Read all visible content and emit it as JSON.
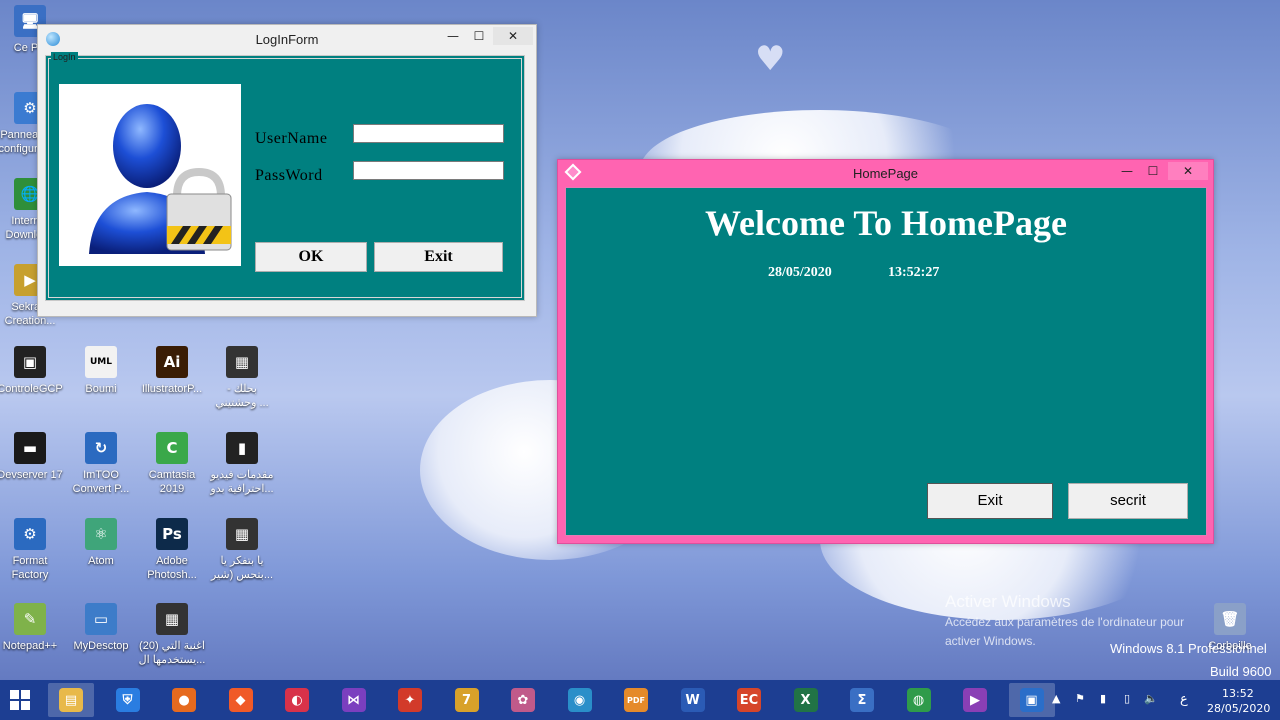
{
  "desktop": {
    "icons": [
      {
        "label": "Ce PC",
        "glyph": "🖥",
        "color": "#3a6fc4"
      },
      {
        "label": "Panneau de configuration",
        "glyph": "⚙",
        "color": "#3b7bd1"
      },
      {
        "label": "Internet Download",
        "glyph": "🌐",
        "color": "#2f8f3a"
      },
      {
        "label": "Sekrani Creation...",
        "glyph": "▶",
        "color": "#c7a02f"
      },
      {
        "label": "ControleGCP",
        "glyph": "▣",
        "color": "#222222"
      },
      {
        "label": "Boumi",
        "glyph": "UML",
        "color": "#f2f2f2"
      },
      {
        "label": "IllustratorP...",
        "glyph": "Ai",
        "color": "#3a1d05"
      },
      {
        "label": "بحلك - وحشتيني ...",
        "glyph": "▦",
        "color": "#333333"
      },
      {
        "label": "Devserver 17",
        "glyph": "▬",
        "color": "#1a1a1a"
      },
      {
        "label": "ImTOO Convert P...",
        "glyph": "↻",
        "color": "#2b6ac0"
      },
      {
        "label": "Camtasia 2019",
        "glyph": "C",
        "color": "#3aa84a"
      },
      {
        "label": "مقدمات فيديو احترافية بدو...",
        "glyph": "▮",
        "color": "#222222"
      },
      {
        "label": "Format Factory",
        "glyph": "⚙",
        "color": "#2b6ac0"
      },
      {
        "label": "Atom",
        "glyph": "⚛",
        "color": "#3fa57a"
      },
      {
        "label": "Adobe Photosh...",
        "glyph": "Ps",
        "color": "#0d2a4a"
      },
      {
        "label": "يا بتفكر يا بتحس (شير...",
        "glyph": "▦",
        "color": "#333333"
      },
      {
        "label": "Notepad++",
        "glyph": "✎",
        "color": "#7fb24a"
      },
      {
        "label": "MyDesctop",
        "glyph": "▭",
        "color": "#3d7cc9"
      },
      {
        "label": "اغنية التي (20) يستخدمها ال...",
        "glyph": "▦",
        "color": "#333333"
      },
      {
        "label": "Corbeille",
        "glyph": "🗑",
        "color": "#8aa0c8"
      }
    ]
  },
  "login_window": {
    "title": "LogInForm",
    "group_label": "LogIn",
    "username_label": "UserName",
    "password_label": "PassWord",
    "username_value": "",
    "password_value": "",
    "ok_label": "OK",
    "exit_label": "Exit",
    "minimize": "—",
    "maximize": "☐",
    "close": "✕"
  },
  "home_window": {
    "title": "HomePage",
    "welcome": "Welcome To HomePage",
    "date": "28/05/2020",
    "time": "13:52:27",
    "exit_label": "Exit",
    "secret_label": "secrit",
    "minimize": "—",
    "maximize": "☐",
    "close": "✕"
  },
  "watermark": {
    "activate_title": "Activer Windows",
    "activate_line1": "Accédez aux paramètres de l'ordinateur pour",
    "activate_line2": "activer Windows.",
    "edition": "Windows 8.1 Professionnel",
    "build": "Build 9600"
  },
  "taskbar": {
    "apps": [
      {
        "name": "file-explorer",
        "glyph": "▤",
        "color": "#e8b94a"
      },
      {
        "name": "shield",
        "glyph": "⛨",
        "color": "#2a7de1"
      },
      {
        "name": "firefox",
        "glyph": "●",
        "color": "#e66a1f"
      },
      {
        "name": "brave",
        "glyph": "◆",
        "color": "#f05a28"
      },
      {
        "name": "opera-neon",
        "glyph": "◐",
        "color": "#d8324a"
      },
      {
        "name": "visual-studio",
        "glyph": "⋈",
        "color": "#7b3fbf"
      },
      {
        "name": "app-red",
        "glyph": "✦",
        "color": "#d23a2a"
      },
      {
        "name": "7zip",
        "glyph": "7",
        "color": "#d8a12a"
      },
      {
        "name": "paint",
        "glyph": "✿",
        "color": "#c05a8a"
      },
      {
        "name": "media",
        "glyph": "◉",
        "color": "#2a8fc9"
      },
      {
        "name": "pdf",
        "glyph": "PDF",
        "color": "#e58a2a"
      },
      {
        "name": "word",
        "glyph": "W",
        "color": "#2b5bb5"
      },
      {
        "name": "app-ec",
        "glyph": "EC",
        "color": "#d6452a"
      },
      {
        "name": "excel",
        "glyph": "X",
        "color": "#217346"
      },
      {
        "name": "math",
        "glyph": "Σ",
        "color": "#3a6fc4"
      },
      {
        "name": "chrome",
        "glyph": "◍",
        "color": "#2f9b4a"
      },
      {
        "name": "app-purple",
        "glyph": "▶",
        "color": "#8a3fb5"
      },
      {
        "name": "app-active",
        "glyph": "▣",
        "color": "#2a6ec9"
      }
    ],
    "lang": "ع",
    "time": "13:52",
    "date": "28/05/2020"
  }
}
